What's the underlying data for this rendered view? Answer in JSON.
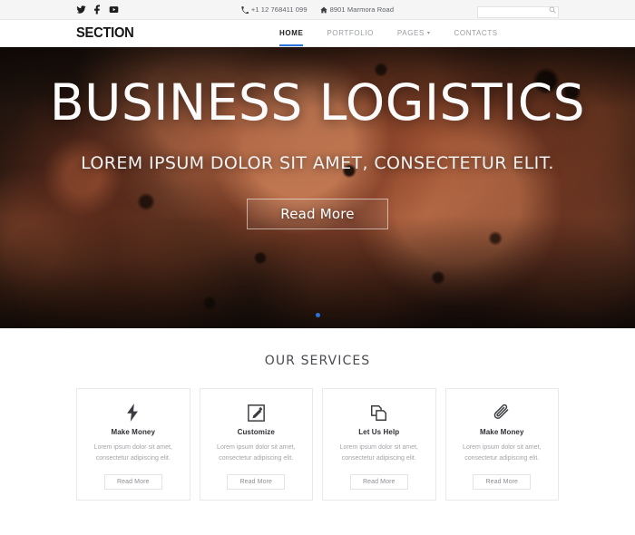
{
  "topbar": {
    "social": [
      {
        "name": "twitter-icon",
        "label": "Twitter"
      },
      {
        "name": "facebook-icon",
        "label": "Facebook"
      },
      {
        "name": "youtube-icon",
        "label": "YouTube"
      }
    ],
    "phone": "+1 12 768411 099",
    "address": "8901 Marmora Road",
    "search_value": "",
    "search_placeholder": ""
  },
  "nav": {
    "brand": "SECTION",
    "items": [
      {
        "label": "HOME",
        "active": true,
        "caret": false
      },
      {
        "label": "PORTFOLIO",
        "active": false,
        "caret": false
      },
      {
        "label": "PAGES",
        "active": false,
        "caret": true
      },
      {
        "label": "CONTACTS",
        "active": false,
        "caret": false
      }
    ]
  },
  "hero": {
    "title": "BUSINESS LOGISTICS",
    "subtitle": "LOREM IPSUM DOLOR SIT AMET, CONSECTETUR ELIT.",
    "button": "Read More",
    "dots": 1,
    "active_dot": 0,
    "accent_color": "#2a73d8"
  },
  "services": {
    "title": "OUR SERVICES",
    "cards": [
      {
        "icon": "lightning-bolt-icon",
        "title": "Make Money",
        "text": "Lorem ipsum dolor sit amet, consectetur adipiscing elit.",
        "button": "Read More"
      },
      {
        "icon": "edit-pencil-icon",
        "title": "Customize",
        "text": "Lorem ipsum dolor sit amet, consectetur adipiscing elit.",
        "button": "Read More"
      },
      {
        "icon": "copy-documents-icon",
        "title": "Let Us Help",
        "text": "Lorem ipsum dolor sit amet, consectetur adipiscing elit.",
        "button": "Read More"
      },
      {
        "icon": "paperclip-icon",
        "title": "Make Money",
        "text": "Lorem ipsum dolor sit amet, consectetur adipiscing elit.",
        "button": "Read More"
      }
    ]
  }
}
